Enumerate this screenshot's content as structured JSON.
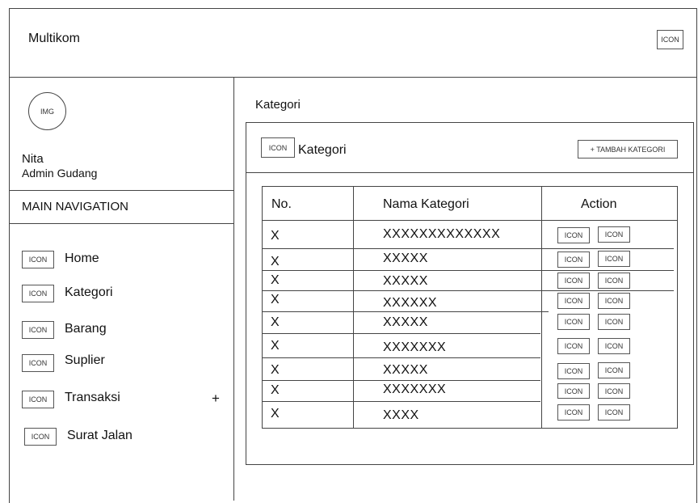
{
  "header": {
    "app_title": "Multikom",
    "icon_label": "ICON"
  },
  "sidebar": {
    "avatar_label": "IMG",
    "user_name": "Nita",
    "user_role": "Admin Gudang",
    "nav_heading": "MAIN NAVIGATION",
    "items": [
      {
        "icon": "ICON",
        "label": "Home"
      },
      {
        "icon": "ICON",
        "label": "Kategori"
      },
      {
        "icon": "ICON",
        "label": "Barang"
      },
      {
        "icon": "ICON",
        "label": "Suplier"
      },
      {
        "icon": "ICON",
        "label": "Transaksi",
        "expand": "+"
      },
      {
        "icon": "ICON",
        "label": "Surat Jalan"
      }
    ]
  },
  "main": {
    "page_title": "Kategori",
    "panel": {
      "icon": "ICON",
      "title": "Kategori",
      "add_button": "+ TAMBAH KATEGORI"
    },
    "table": {
      "headers": [
        "No.",
        "Nama Kategori",
        "Action"
      ],
      "action_icon": "ICON",
      "rows": [
        {
          "no": "X",
          "name": "XXXXXXXXXXXXX"
        },
        {
          "no": "X",
          "name": "XXXXX"
        },
        {
          "no": "X",
          "name": "XXXXX"
        },
        {
          "no": "X",
          "name": "XXXXXX"
        },
        {
          "no": "X",
          "name": "XXXXX"
        },
        {
          "no": "X",
          "name": "XXXXXXX"
        },
        {
          "no": "X",
          "name": "XXXXX"
        },
        {
          "no": "X",
          "name": "XXXXXXX"
        },
        {
          "no": "X",
          "name": "XXXX"
        }
      ]
    }
  }
}
